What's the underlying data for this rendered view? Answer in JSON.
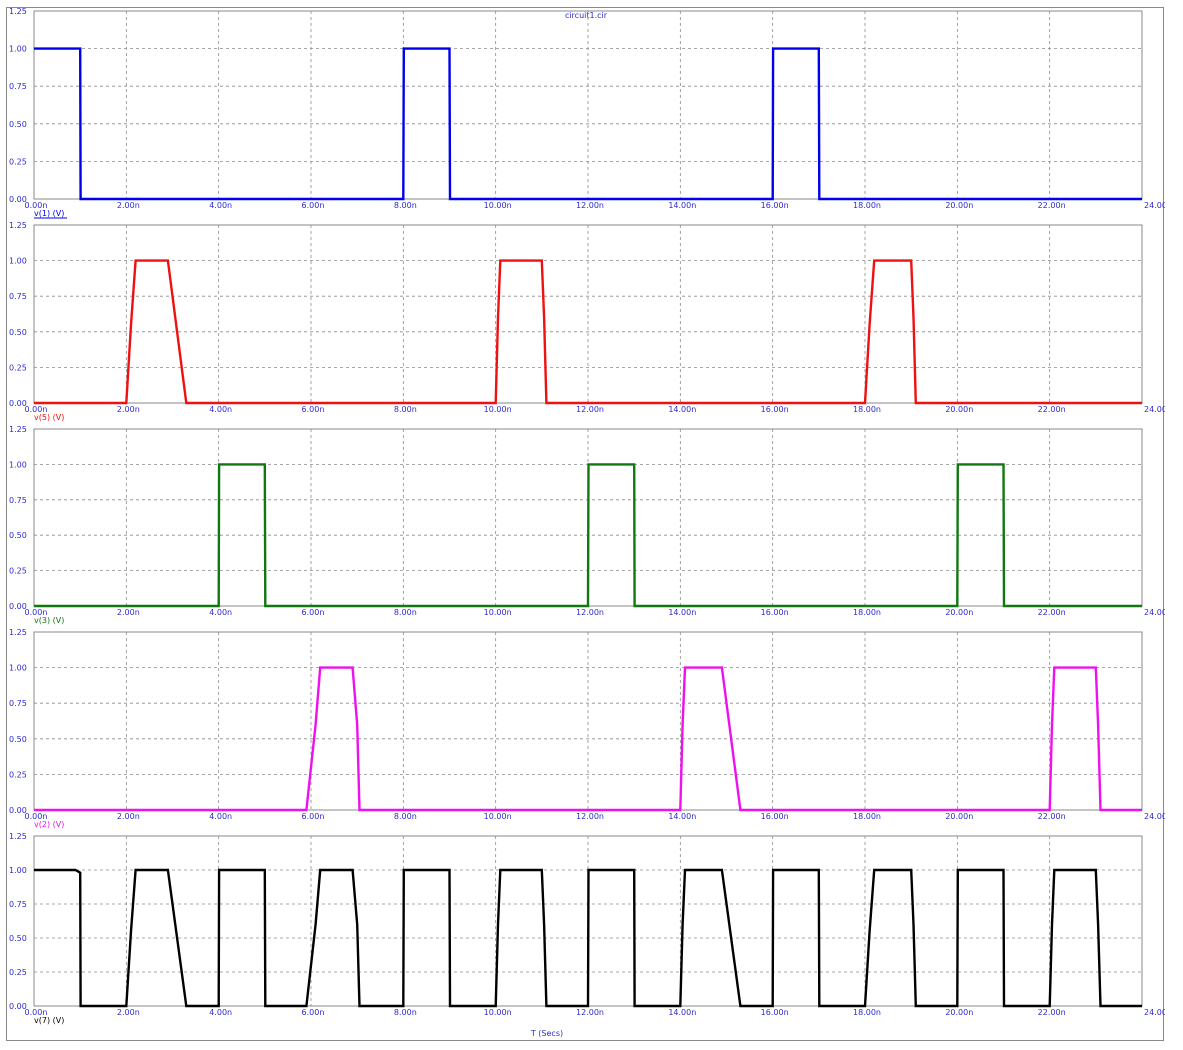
{
  "window": {
    "title": "circuit1.cir"
  },
  "colors": {
    "axis_text": "#2a2ad0",
    "grid": "#8c8c8c",
    "frame": "#8a8a8a",
    "traces": {
      "v1": "#0000ee",
      "v5": "#ee1111",
      "v3": "#117711",
      "v2": "#ee11ee",
      "v7": "#000000"
    }
  },
  "x_axis": {
    "label": "T (Secs)",
    "range": [
      0,
      24
    ],
    "unit_suffix": "n",
    "tick_labels": [
      "0.00n",
      "2.00n",
      "4.00n",
      "6.00n",
      "8.00n",
      "10.00n",
      "12.00n",
      "14.00n",
      "16.00n",
      "18.00n",
      "20.00n",
      "22.00n",
      "24.00n"
    ]
  },
  "chart_data": [
    {
      "type": "line",
      "series": [
        {
          "name": "v(1) (V)",
          "color_key": "v1",
          "x": [
            0,
            0.01,
            1,
            1.01,
            8,
            8.01,
            9,
            9.01,
            16,
            16.01,
            17,
            17.01,
            24
          ],
          "y": [
            1,
            1,
            1,
            0,
            0,
            1,
            1,
            0,
            0,
            1,
            1,
            0,
            0
          ]
        }
      ],
      "ylim": [
        0,
        1.25
      ],
      "y_tick_labels": [
        "0.00",
        "0.25",
        "0.50",
        "0.75",
        "1.00",
        "1.25"
      ],
      "grid": true
    },
    {
      "type": "line",
      "series": [
        {
          "name": "v(5) (V)",
          "color_key": "v5",
          "x": [
            0,
            2,
            2.1,
            2.2,
            2.9,
            3.3,
            24,
            10,
            10.05,
            10.1,
            11,
            11.05,
            11.1,
            18,
            18.1,
            18.2,
            19,
            19.05,
            19.1
          ],
          "y": [
            0,
            0,
            0.55,
            1,
            1,
            0,
            0,
            0,
            0.6,
            1,
            1,
            0.6,
            0,
            0,
            0.55,
            1,
            1,
            0.6,
            0
          ]
        }
      ],
      "ylim": [
        0,
        1.25
      ],
      "y_tick_labels": [
        "0.00",
        "0.25",
        "0.50",
        "0.75",
        "1.00",
        "1.25"
      ],
      "grid": true
    },
    {
      "type": "line",
      "series": [
        {
          "name": "v(3) (V)",
          "color_key": "v3",
          "x": [
            0,
            4,
            4.01,
            5,
            5.01,
            12,
            12.01,
            13,
            13.01,
            20,
            20.01,
            21,
            21.01,
            24
          ],
          "y": [
            0,
            0,
            1,
            1,
            0,
            0,
            1,
            1,
            0,
            0,
            1,
            1,
            0,
            0
          ]
        }
      ],
      "ylim": [
        0,
        1.25
      ],
      "y_tick_labels": [
        "0.00",
        "0.25",
        "0.50",
        "0.75",
        "1.00",
        "1.25"
      ],
      "grid": true
    },
    {
      "type": "line",
      "series": [
        {
          "name": "v(2) (V)",
          "color_key": "v2",
          "x": [
            0,
            5.9,
            6.1,
            6.2,
            6.9,
            7.0,
            7.05,
            14,
            14.05,
            14.1,
            14.9,
            15.3,
            22,
            22.05,
            22.1,
            23,
            23.05,
            23.1,
            24
          ],
          "y": [
            0,
            0,
            0.6,
            1,
            1,
            0.6,
            0,
            0,
            0.6,
            1,
            1,
            0,
            0,
            0.6,
            1,
            1,
            0.6,
            0,
            0
          ]
        }
      ],
      "ylim": [
        0,
        1.25
      ],
      "y_tick_labels": [
        "0.00",
        "0.25",
        "0.50",
        "0.75",
        "1.00",
        "1.25"
      ],
      "grid": true
    },
    {
      "type": "line",
      "series": [
        {
          "name": "v(7) (V)",
          "color_key": "v7",
          "x": [
            0,
            0.01,
            0.9,
            1.0,
            1.01,
            2,
            2.1,
            2.2,
            2.9,
            3.3,
            4,
            4.01,
            5,
            5.01,
            5.9,
            6.1,
            6.2,
            6.9,
            7.0,
            7.05,
            8,
            8.01,
            9,
            9.01,
            10,
            10.05,
            10.1,
            11,
            11.05,
            11.1,
            12,
            12.01,
            13,
            13.01,
            14,
            14.05,
            14.1,
            14.9,
            15.3,
            16,
            16.01,
            17,
            17.01,
            18,
            18.1,
            18.2,
            19,
            19.05,
            19.1,
            20,
            20.01,
            21,
            21.01,
            22,
            22.05,
            22.1,
            23,
            23.05,
            23.1,
            24
          ],
          "y": [
            1,
            1,
            1,
            0.98,
            0,
            0,
            0.55,
            1,
            1,
            0,
            0,
            1,
            1,
            0,
            0,
            0.6,
            1,
            1,
            0.6,
            0,
            0,
            1,
            1,
            0,
            0,
            0.6,
            1,
            1,
            0.6,
            0,
            0,
            1,
            1,
            0,
            0,
            0.6,
            1,
            1,
            0,
            0,
            1,
            1,
            0,
            0,
            0.55,
            1,
            1,
            0.6,
            0,
            0,
            1,
            1,
            0,
            0,
            0.6,
            1,
            1,
            0.6,
            0,
            0
          ]
        }
      ],
      "ylim": [
        0,
        1.25
      ],
      "y_tick_labels": [
        "0.00",
        "0.25",
        "0.50",
        "0.75",
        "1.00",
        "1.25"
      ],
      "grid": true
    }
  ]
}
